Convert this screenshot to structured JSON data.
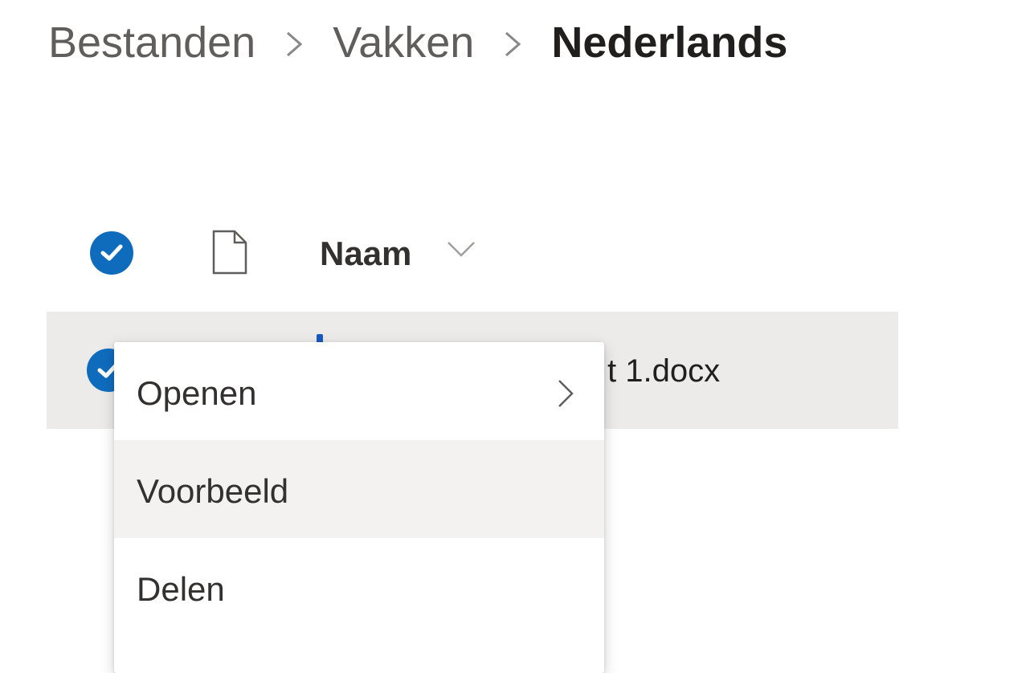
{
  "breadcrumb": {
    "items": [
      "Bestanden",
      "Vakken",
      "Nederlands"
    ]
  },
  "list_header": {
    "name_column": "Naam",
    "select_all_checked": true
  },
  "files": [
    {
      "name_visible": "t 1.docx",
      "selected": true
    }
  ],
  "context_menu": {
    "items": [
      {
        "label": "Openen",
        "has_submenu": true
      },
      {
        "label": "Voorbeeld",
        "hovered": true
      },
      {
        "label": "Delen"
      }
    ]
  },
  "colors": {
    "accent": "#0f6cbd",
    "selected_row": "#edebe9",
    "menu_hover": "#f3f2f1"
  }
}
